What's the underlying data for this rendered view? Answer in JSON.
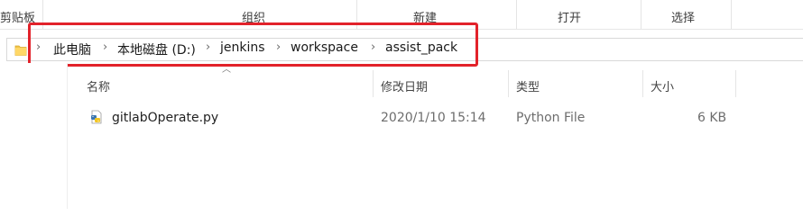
{
  "ribbon": {
    "groups": [
      "剪贴板",
      "组织",
      "新建",
      "打开",
      "选择"
    ]
  },
  "address_bar": {
    "crumbs": [
      "此电脑",
      "本地磁盘 (D:)",
      "jenkins",
      "workspace",
      "assist_pack"
    ]
  },
  "columns": {
    "name": "名称",
    "modified": "修改日期",
    "type": "类型",
    "size": "大小"
  },
  "files": [
    {
      "name": "gitlabOperate.py",
      "modified": "2020/1/10 15:14",
      "type": "Python File",
      "size": "6 KB",
      "icon": "python-file-icon"
    }
  ],
  "colors": {
    "highlight": "#e2222a"
  }
}
